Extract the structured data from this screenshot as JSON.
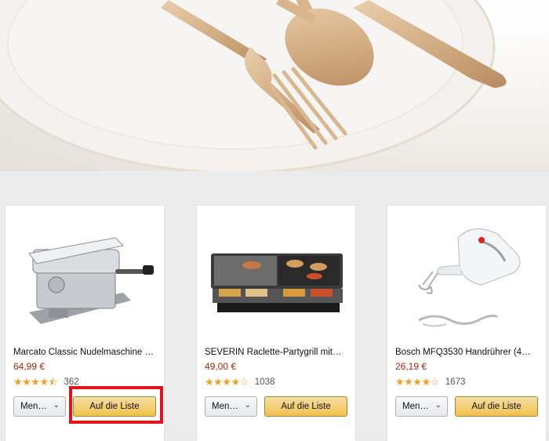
{
  "hero": {
    "alt_icon": "cutlery-on-plate-banner"
  },
  "products": [
    {
      "title": "Marcato Classic Nudelmaschine …",
      "price": "64,99 €",
      "rating_stars": 4.5,
      "reviews": "362",
      "menu_label": "Men…",
      "list_label": "Auf die Liste",
      "image_icon": "pasta-machine-image"
    },
    {
      "title": "SEVERIN Raclette-Partygrill mit…",
      "price": "49,00 €",
      "rating_stars": 4,
      "reviews": "1038",
      "menu_label": "Men…",
      "list_label": "Auf die Liste",
      "image_icon": "raclette-grill-image"
    },
    {
      "title": "Bosch MFQ3530 Handrührer (4…",
      "price": "26,19 €",
      "rating_stars": 4,
      "reviews": "1673",
      "menu_label": "Men…",
      "list_label": "Auf die Liste",
      "image_icon": "hand-mixer-image"
    }
  ],
  "colors": {
    "price": "#b12704",
    "star": "#f0a023",
    "list_button": "#f0c14b",
    "highlight": "#e2141c"
  }
}
